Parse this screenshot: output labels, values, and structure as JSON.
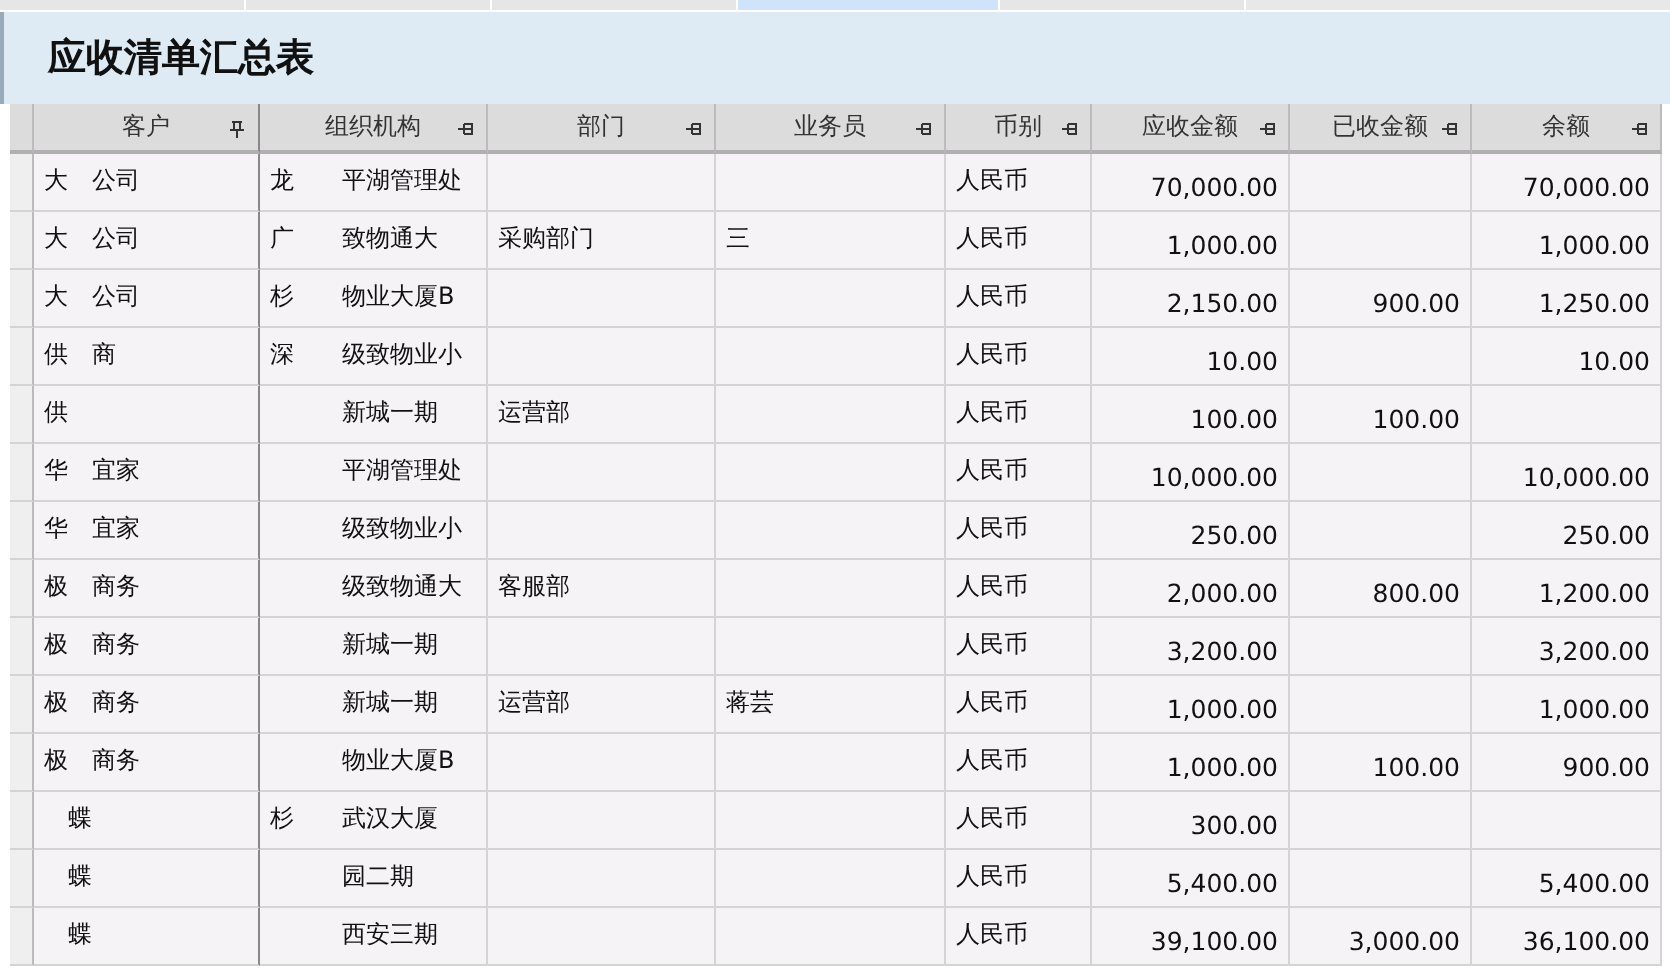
{
  "tabs": [
    {
      "selected": false
    },
    {
      "selected": false
    },
    {
      "selected": false
    },
    {
      "selected": true
    },
    {
      "selected": false
    }
  ],
  "title": "应收清单汇总表",
  "table": {
    "columns": [
      "客户",
      "组织机构",
      "部门",
      "业务员",
      "币别",
      "应收金额",
      "已收金额",
      "余额"
    ],
    "rows": [
      [
        "大　公司",
        "龙　　平湖管理处",
        "",
        "",
        "人民币",
        "70,000.00",
        "",
        "70,000.00"
      ],
      [
        "大　公司",
        "广　　致物通大",
        "采购部门",
        "三",
        "人民币",
        "1,000.00",
        "",
        "1,000.00"
      ],
      [
        "大　公司",
        "杉　　物业大厦B",
        "",
        "",
        "人民币",
        "2,150.00",
        "900.00",
        "1,250.00"
      ],
      [
        "供　商",
        "深　　级致物业小",
        "",
        "",
        "人民币",
        "10.00",
        "",
        "10.00"
      ],
      [
        "供",
        "　　　新城一期",
        "运营部",
        "",
        "人民币",
        "100.00",
        "100.00",
        ""
      ],
      [
        "华　宜家",
        "　　　平湖管理处",
        "",
        "",
        "人民币",
        "10,000.00",
        "",
        "10,000.00"
      ],
      [
        "华　宜家",
        "　　　级致物业小",
        "",
        "",
        "人民币",
        "250.00",
        "",
        "250.00"
      ],
      [
        "极　商务",
        "　　　级致物通大",
        "客服部",
        "",
        "人民币",
        "2,000.00",
        "800.00",
        "1,200.00"
      ],
      [
        "极　商务",
        "　　　新城一期",
        "",
        "",
        "人民币",
        "3,200.00",
        "",
        "3,200.00"
      ],
      [
        "极　商务",
        "　　　新城一期",
        "运营部",
        "蒋芸",
        "人民币",
        "1,000.00",
        "",
        "1,000.00"
      ],
      [
        "极　商务",
        "　　　物业大厦B",
        "",
        "",
        "人民币",
        "1,000.00",
        "100.00",
        "900.00"
      ],
      [
        "　蝶",
        "杉　　武汉大厦",
        "",
        "",
        "人民币",
        "300.00",
        "",
        ""
      ],
      [
        "　蝶",
        "　　　园二期",
        "",
        "",
        "人民币",
        "5,400.00",
        "",
        "5,400.00"
      ],
      [
        "　蝶",
        "　　　西安三期",
        "",
        "",
        "人民币",
        "39,100.00",
        "3,000.00",
        "36,100.00"
      ]
    ]
  }
}
